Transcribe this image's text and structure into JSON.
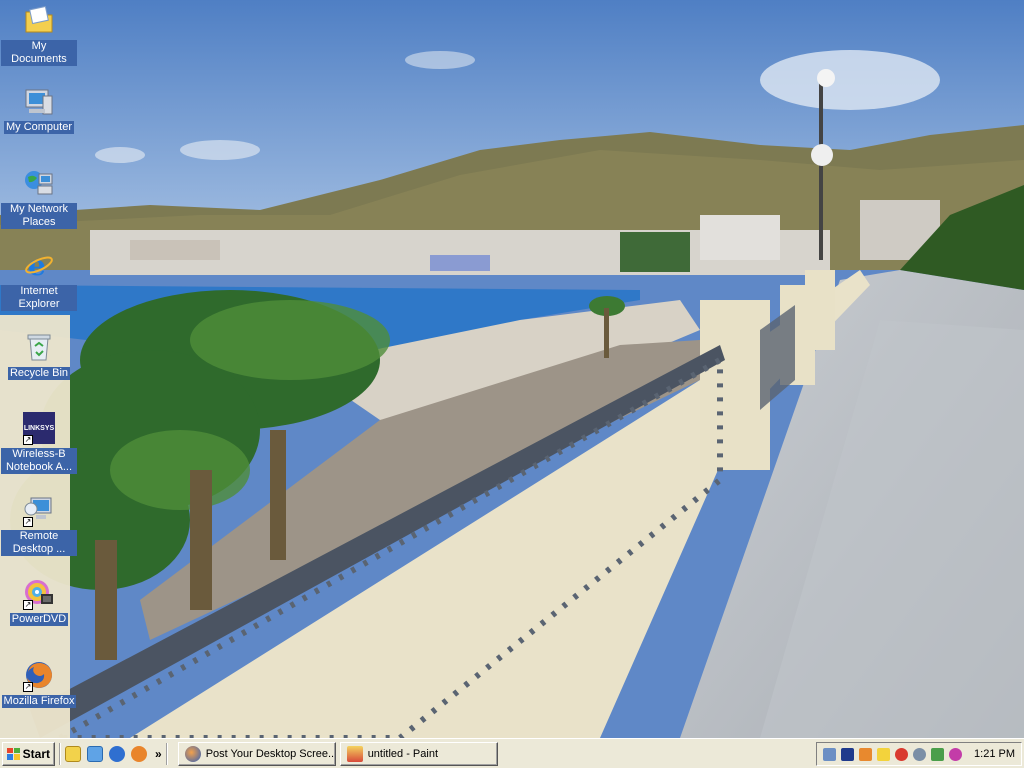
{
  "desktop": {
    "icons": [
      {
        "label": "My Documents",
        "icon": "my-documents-folder-icon"
      },
      {
        "label": "My Computer",
        "icon": "my-computer-icon"
      },
      {
        "label": "My Network Places",
        "icon": "network-places-icon"
      },
      {
        "label": "Internet Explorer",
        "icon": "internet-explorer-icon"
      },
      {
        "label": "Recycle Bin",
        "icon": "recycle-bin-icon"
      },
      {
        "label": "Wireless-B Notebook A...",
        "icon": "linksys-icon",
        "badge": "LINKSYS"
      },
      {
        "label": "Remote Desktop ...",
        "icon": "remote-desktop-icon"
      },
      {
        "label": "PowerDVD",
        "icon": "powerdvd-icon"
      },
      {
        "label": "Mozilla Firefox",
        "icon": "firefox-icon"
      }
    ],
    "wallpaper": "seaside-promenade-photo"
  },
  "taskbar": {
    "start_label": "Start",
    "quick_launch": [
      "outlook-express-icon",
      "internet-explorer-icon",
      "media-player-icon",
      "firefox-icon"
    ],
    "overflow_label": "»",
    "tasks": [
      {
        "label": "Post Your Desktop Scree...",
        "icon": "firefox-icon"
      },
      {
        "label": "untitled - Paint",
        "icon": "paint-icon"
      }
    ],
    "tray_icons": [
      "network-icon",
      "security-icon",
      "volume-icon",
      "update-icon",
      "antivirus-icon",
      "messenger-icon",
      "printer-icon",
      "media-icon"
    ],
    "clock": "1:21 PM"
  },
  "colors": {
    "taskbar_bg": "#ece9d8",
    "icon_label_bg": "#3c64a8",
    "sky": "#5f88c7",
    "sea": "#2f78c8"
  }
}
